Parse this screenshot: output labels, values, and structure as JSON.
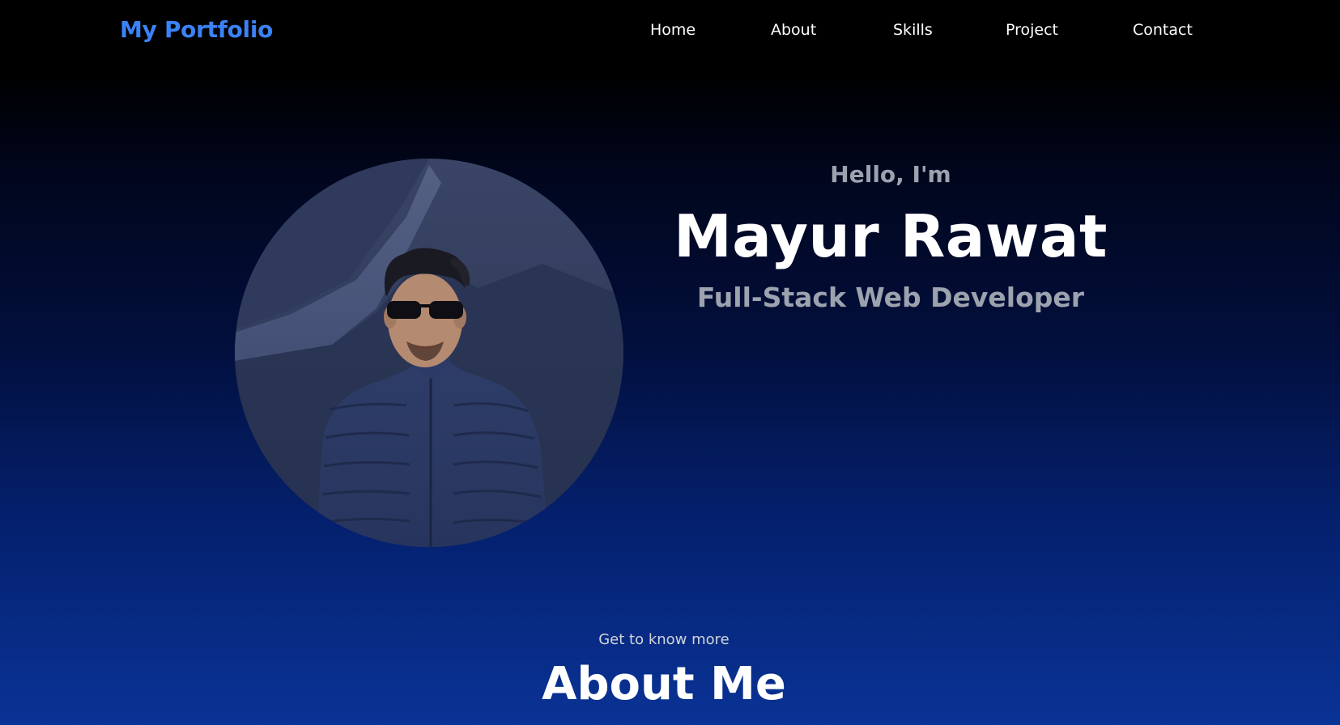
{
  "header": {
    "logo": "My Portfolio",
    "nav": [
      "Home",
      "About",
      "Skills",
      "Project",
      "Contact"
    ]
  },
  "hero": {
    "greeting": "Hello, I'm",
    "name": "Mayur Rawat",
    "role": "Full-Stack Web Developer",
    "photo_alt": "profile-photo"
  },
  "about": {
    "subtitle": "Get to know more",
    "title": "About Me"
  },
  "colors": {
    "accent": "#3b82f6",
    "muted_text": "#9ca3af",
    "bg_top": "#000000",
    "bg_bottom": "#0a3396"
  }
}
